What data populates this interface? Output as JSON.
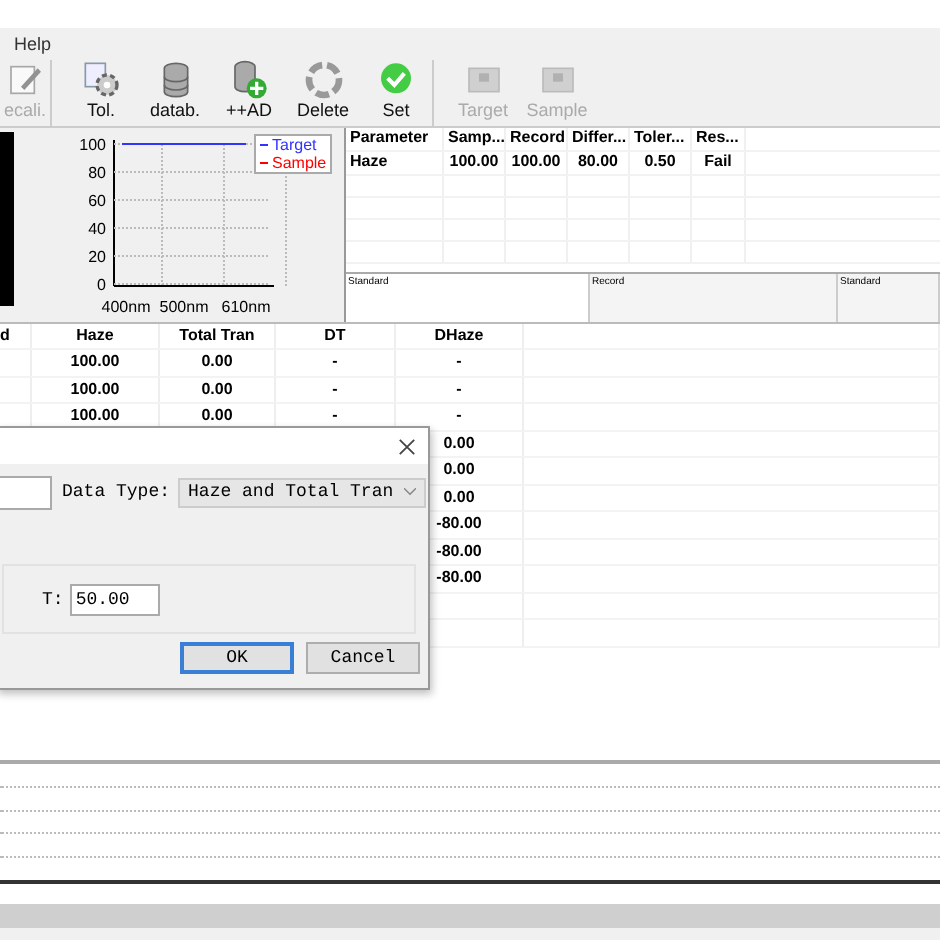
{
  "menu": [
    "Help"
  ],
  "toolbar": [
    {
      "label": "ecali.",
      "kind": "edit",
      "disabled": true
    },
    {
      "label": "Tol.",
      "kind": "tolerance",
      "disabled": false
    },
    {
      "label": "datab.",
      "kind": "database",
      "disabled": false
    },
    {
      "label": "++AD",
      "kind": "add",
      "disabled": false
    },
    {
      "label": "Delete",
      "kind": "recycle",
      "disabled": false
    },
    {
      "label": "Set",
      "kind": "check",
      "disabled": false
    },
    {
      "label": "Target",
      "kind": "device",
      "disabled": true
    },
    {
      "label": "Sample",
      "kind": "device",
      "disabled": true
    }
  ],
  "chart": {
    "chart_data": {
      "type": "line",
      "grid": true,
      "categories": [
        "400nm",
        "500nm",
        "610nm"
      ],
      "ylim": [
        0,
        100
      ],
      "yticks": [
        0,
        20,
        40,
        60,
        80,
        100
      ],
      "series": [
        {
          "name": "Target",
          "color": "#3333ff",
          "values": [
            100,
            100,
            100
          ]
        },
        {
          "name": "Sample",
          "color": "#ff0000",
          "values": [
            null,
            null,
            null
          ]
        }
      ]
    }
  },
  "parameters": {
    "columns": [
      "Parameter",
      "Samp...",
      "Record",
      "Differ...",
      "Toler...",
      "Res..."
    ],
    "rows": [
      [
        "Haze",
        "100.00",
        "100.00",
        "80.00",
        "0.50",
        "Fail"
      ]
    ]
  },
  "panels": [
    "Standard",
    "Record",
    "Standard"
  ],
  "results": {
    "columns": [
      "d",
      "Haze",
      "Total Tran",
      "DT",
      "DHaze"
    ],
    "rows": [
      [
        "",
        "100.00",
        "0.00",
        "-",
        "-"
      ],
      [
        "",
        "100.00",
        "0.00",
        "-",
        "-"
      ],
      [
        "",
        "100.00",
        "0.00",
        "-",
        "-"
      ],
      [
        "",
        "",
        "",
        "",
        "0.00"
      ],
      [
        "",
        "",
        "",
        "",
        "0.00"
      ],
      [
        "",
        "",
        "",
        "",
        "0.00"
      ],
      [
        "",
        "",
        "",
        "",
        "-80.00"
      ],
      [
        "",
        "",
        "",
        "",
        "-80.00"
      ],
      [
        "",
        "",
        "",
        "",
        "-80.00"
      ]
    ]
  },
  "dialog": {
    "data_type_label": "Data Type:",
    "data_type_value": "Haze and Total Tran",
    "t_label": "T:",
    "t_value": "50.00",
    "buttons": [
      {
        "label": "OK",
        "selected": true
      },
      {
        "label": "Cancel",
        "selected": false
      }
    ]
  }
}
